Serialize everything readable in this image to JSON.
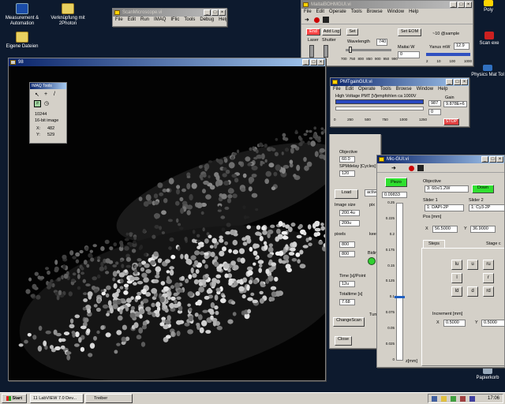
{
  "desktop": {
    "icons": [
      {
        "label": "Measurement & Automation"
      },
      {
        "label": "Verknüpfung mit 2Photon"
      },
      {
        "label": "Eigene Dateien"
      }
    ],
    "right_labels": [
      "Poly",
      "Scan exe",
      "Physics Mat Tol",
      "Papierkorb"
    ]
  },
  "scan_win": {
    "title": "ScanMicroscope.vi",
    "menu": [
      "File",
      "Edit",
      "Run",
      "IMAQ",
      "IFlic",
      "Tools",
      "Debug",
      "Help"
    ]
  },
  "ag_win": {
    "title": "MaitaiBOHMGUI.vi",
    "menu": [
      "File",
      "Edit",
      "Operate",
      "Tools",
      "Browse",
      "Window",
      "Help"
    ],
    "end": "End",
    "add_log": "Add Log",
    "set": "Set",
    "set_eom": "Set EOM",
    "laser": "Laser",
    "shutter": "Shutter",
    "wavelength_label": "Wavelength",
    "wavelength": "740",
    "sample_label": "~10 @sample",
    "maitai_label": "Maitai W",
    "maitai_value": "0",
    "yanus_label": "Yanus mW",
    "yanus_value": "12.9",
    "slider_ticks": [
      "700",
      "750",
      "800",
      "850",
      "900",
      "950",
      "990"
    ],
    "yanus_ticks": [
      "2",
      "10",
      "100",
      "1000"
    ]
  },
  "pmt_win": {
    "title": "PMTgainGUI.vi",
    "menu": [
      "File",
      "Edit",
      "Operate",
      "Tools",
      "Browse",
      "Window",
      "Help"
    ],
    "hv_label": "High Voltage PMT [V]",
    "hv_note": "empfohlen ca 1000V",
    "gain_label": "Gain",
    "hv_value": "987",
    "gain_value": "9.878E+6",
    "second_value": "0",
    "stop": "STOP",
    "ticks": [
      "0",
      "250",
      "500",
      "750",
      "1000",
      "1250"
    ]
  },
  "image_win": {
    "title": "98",
    "imaq_tools": {
      "title": "IMAQ Tools",
      "value": "10244",
      "type": "16-bit image",
      "x_label": "X:",
      "x": "482",
      "y_label": "Y:",
      "y": "529"
    }
  },
  "settings": {
    "objective_label": "Objective",
    "objective": "60.0",
    "spm_label": "SPMdelay [Cycles]",
    "spm": "120",
    "load": "Load",
    "active": "active",
    "image_size_label": "Image size",
    "px_label": "pix",
    "size1": "200.4u",
    "size2": "200u",
    "pixels_label": "pixels",
    "keep_label": "kee",
    "pix1": "800",
    "pix2": "800",
    "bidir_label": "Bidir",
    "time_label": "Time [s]/Point",
    "time": "12u",
    "total_label": "Totaltime [s]",
    "total": "7.68",
    "turn_label": "Turn",
    "change_scan": "ChangeScan",
    "close": "Close"
  },
  "mic_win": {
    "title": "Mic-GUI.vi",
    "piezo": "Piezo",
    "zval": "0.09833",
    "z_ticks": [
      "0.25",
      "0.225",
      "0.2",
      "0.175",
      "0.15",
      "0.125",
      "0.1",
      "0.075",
      "0.05",
      "0.025",
      "0"
    ],
    "z_label": "z[mm]",
    "objective_label": "Objective",
    "objective": "3: 60x/1.2W",
    "down": "Down",
    "slider1_label": "Slider 1",
    "slider1": "1: DAPI-2P",
    "slider2_label": "Slider 2",
    "slider2": "1: Cy3-2P",
    "pos_label": "Pos [mm]",
    "x_label": "X",
    "x": "56.5000",
    "y_label": "Y",
    "y": "36.9000",
    "steps_tab": "Steps",
    "stage_tab": "Stage c",
    "dirs": [
      "lu",
      "u",
      "ru",
      "l",
      "",
      "r",
      "ld",
      "d",
      "rd"
    ],
    "incr_label": "Increment [mm]",
    "ix": "0.5000",
    "iy": "0.5000",
    "ix_label": "X",
    "iy_label": "Y"
  },
  "taskbar": {
    "start": "Start",
    "task1": "11 LabVIEW 7.0 Dev...",
    "task2": "Treiber",
    "clock": "17:06"
  }
}
